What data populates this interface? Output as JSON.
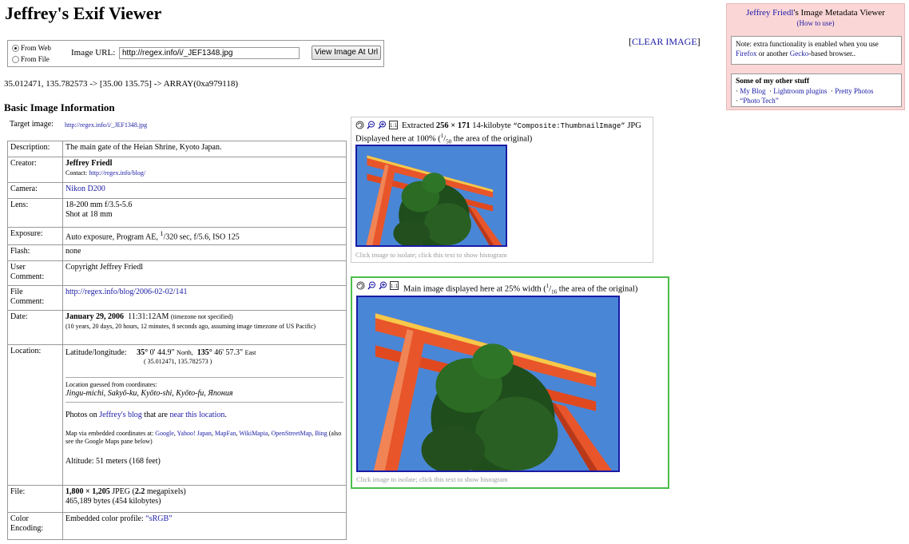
{
  "title": "Jeffrey's Exif Viewer",
  "form": {
    "radio_web": "From Web",
    "radio_file": "From File",
    "url_label": "Image URL:",
    "url_value": "http://regex.info/i/_JEF1348.jpg",
    "view_button": "View Image At Url"
  },
  "clear_image": {
    "bracket_open": "[",
    "label": "CLEAR IMAGE",
    "bracket_close": "]"
  },
  "coords_line": "35.012471, 135.782573 -> [35.00 135.75] -> ARRAY(0xa979118)",
  "sidebar": {
    "author": "Jeffrey Friedl",
    "heading_rest": "'s Image Metadata Viewer",
    "how_to": "(How to use)",
    "note_pre": "Note: extra functionality is enabled when you use",
    "firefox": "Firefox",
    "note_mid": "or another",
    "gecko": "Gecko",
    "note_post": "-based browser..",
    "stuff_head": "Some of my other stuff",
    "links": [
      "My Blog",
      "Lightroom plugins",
      "Pretty Photos",
      "“Photo Tech”"
    ]
  },
  "basic": {
    "heading": "Basic Image Information",
    "target_label": "Target image:",
    "target_url": "http://regex.info/i/_JEF1348.jpg"
  },
  "info": {
    "description": {
      "label": "Description:",
      "value": "The main gate of the Heian Shrine, Kyoto Japan."
    },
    "creator": {
      "label": "Creator:",
      "name": "Jeffrey Friedl",
      "contact_label": "Contact:",
      "contact_url": "http://regex.info/blog/"
    },
    "camera": {
      "label": "Camera:",
      "value": "Nikon D200"
    },
    "lens": {
      "label": "Lens:",
      "line1": "18-200 mm f/3.5-5.6",
      "line2": "Shot at 18 mm"
    },
    "exposure": {
      "label": "Exposure:",
      "pre": "Auto exposure, Program AE,",
      "num": "1",
      "post": "/320 sec, f/5.6, ISO 125"
    },
    "flash": {
      "label": "Flash:",
      "value": "none"
    },
    "user_comment": {
      "label1": "User",
      "label2": "Comment:",
      "value": "Copyright Jeffrey Friedl"
    },
    "file_comment": {
      "label1": "File",
      "label2": "Comment:",
      "value": "http://regex.info/blog/2006-02-02/141"
    },
    "date": {
      "label": "Date:",
      "date": "January 29, 2006",
      "time": "11:31:12AM",
      "tz": "(timezone not specified)",
      "ago": "(10 years, 20 days, 20 hours, 12 minutes, 8 seconds ago, assuming image timezone of US Pacific)"
    },
    "location": {
      "label": "Location:",
      "latlong_label": "Latitude/longitude:",
      "lat_deg": "35°",
      "lat_rest": "0' 44.9\"",
      "north": "North,",
      "lon_deg": "135°",
      "lon_rest": "46' 57.3\"",
      "east": "East",
      "decimal": "( 35.012471, 135.782573 )",
      "guessed": "Location guessed from coordinates:",
      "place": "Jingu-michi, Sakyō-ku, Kyōto-shi, Kyōto-fu, Япония",
      "photos_pre": "Photos on",
      "photos_blog": "Jeffrey's blog",
      "photos_mid": "that are",
      "photos_near": "near this location",
      "photos_end": ".",
      "map_pre": "Map via embedded coordinates at:",
      "map_links": [
        "Google",
        "Yahoo! Japan",
        "MapFan",
        "WikiMapia",
        "OpenStreetMap",
        "Bing"
      ],
      "map_post": "(also see the Google Maps pane below)",
      "altitude": "Altitude: 51 meters (168 feet)"
    },
    "file": {
      "label": "File:",
      "dims": "1,800 × 1,205",
      "jpeg": "JPEG (",
      "mp": "2.2",
      "mp_post": "megapixels)",
      "bytes": "465,189 bytes (454 kilobytes)"
    },
    "color": {
      "label1": "Color",
      "label2": "Encoding:",
      "pre": "Embedded color profile:",
      "profile": "“sRGB”"
    }
  },
  "thumb_panel": {
    "extracted": "Extracted",
    "dims": "256 × 171",
    "mid": "14-kilobyte",
    "tag": "“Composite:ThumbnailImage”",
    "jpg": "JPG",
    "line2_pre": "Displayed here at 100% (",
    "frac_num": "1",
    "frac_den": "50",
    "line2_post": "the area of the original)",
    "footer": "Click image to isolate; click this text to show histogram"
  },
  "main_panel": {
    "caption_pre": "Main image displayed here at 25% width (",
    "frac_num": "1",
    "frac_den": "16",
    "caption_post": "the area of the original)",
    "footer": "Click image to isolate; click this text to show histogram"
  },
  "icons": [
    "rotate-icon",
    "zoom-out-icon",
    "zoom-in-icon",
    "actual-size-icon"
  ],
  "colors": {
    "link": "#1a1aa6",
    "sidebar_bg": "#fbd6d6",
    "main_panel_border": "#4bbe4b",
    "torii": "#e8552a",
    "sky": "#4a86d6"
  }
}
